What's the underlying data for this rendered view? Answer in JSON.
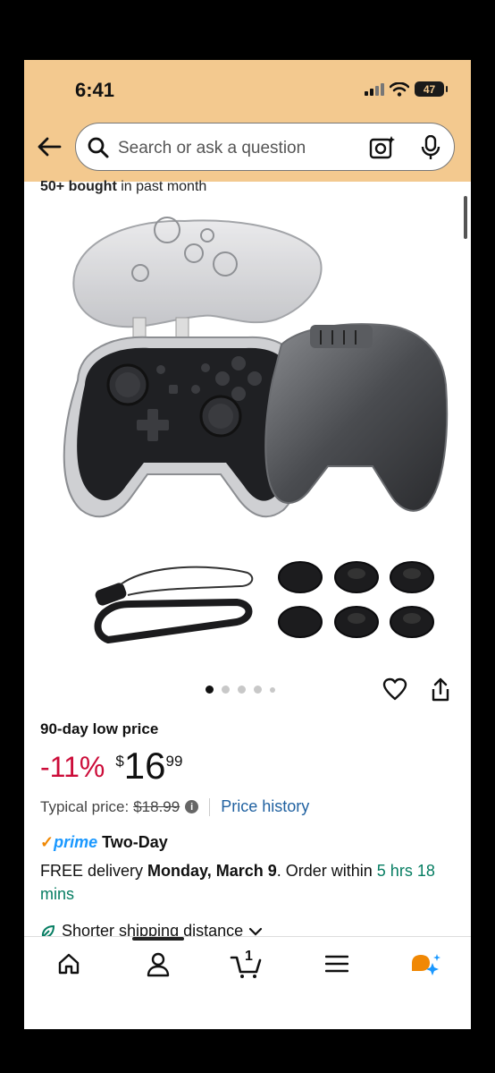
{
  "status_bar": {
    "time": "6:41",
    "battery": "47"
  },
  "search": {
    "placeholder": "Search or ask a question"
  },
  "clipped_text": {
    "bold": "50+ bought",
    "rest": " in past month"
  },
  "gallery": {
    "page_count": 5,
    "active_index": 0
  },
  "deal": {
    "badge": "90-day low price",
    "discount": "-11%",
    "currency": "$",
    "price_whole": "16",
    "price_fraction": "99",
    "typical_label": "Typical price:",
    "typical_value": "$18.99",
    "info_glyph": "i",
    "price_history_link": "Price history"
  },
  "shipping": {
    "check": "✓",
    "prime_word": "prime",
    "two_day": "Two-Day",
    "delivery_prefix": "FREE delivery ",
    "delivery_date": "Monday, March 9",
    "delivery_mid": ". Order within ",
    "countdown": "5 hrs 18 mins",
    "shorter": "Shorter shipping distance"
  },
  "nav": {
    "cart_count": "1"
  },
  "icons": [
    "back-arrow-icon",
    "search-icon",
    "camera-sparkle-icon",
    "microphone-icon",
    "heart-icon",
    "share-icon",
    "leaf-icon",
    "chevron-down-icon",
    "home-icon",
    "account-icon",
    "cart-icon",
    "menu-icon",
    "rufus-icon"
  ],
  "colors": {
    "header_bg": "#f3c98f",
    "discount": "#cc0c39",
    "link": "#2162a1",
    "prime_blue": "#1a98ff",
    "prime_check": "#f08804",
    "countdown_green": "#067d62"
  }
}
